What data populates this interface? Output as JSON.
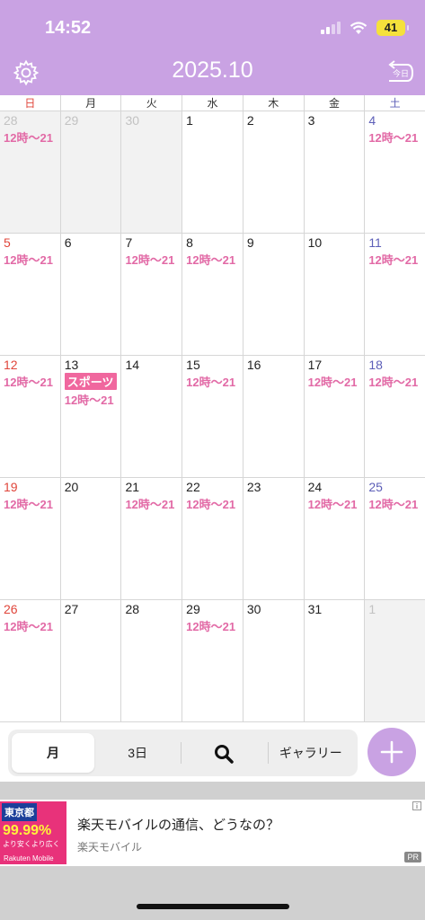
{
  "status": {
    "time": "14:52",
    "battery": "41"
  },
  "header": {
    "title": "2025.10",
    "today_label": "今日"
  },
  "weekdays": [
    "日",
    "月",
    "火",
    "水",
    "木",
    "金",
    "土"
  ],
  "weeks": [
    [
      {
        "day": "28",
        "other": true,
        "shift": "12時～21"
      },
      {
        "day": "29",
        "other": true
      },
      {
        "day": "30",
        "other": true
      },
      {
        "day": "1"
      },
      {
        "day": "2"
      },
      {
        "day": "3"
      },
      {
        "day": "4",
        "shift": "12時～21"
      }
    ],
    [
      {
        "day": "5",
        "shift": "12時～21"
      },
      {
        "day": "6"
      },
      {
        "day": "7",
        "shift": "12時～21"
      },
      {
        "day": "8",
        "shift": "12時～21"
      },
      {
        "day": "9"
      },
      {
        "day": "10"
      },
      {
        "day": "11",
        "shift": "12時～21"
      }
    ],
    [
      {
        "day": "12",
        "shift": "12時～21"
      },
      {
        "day": "13",
        "tag": "スポーツ",
        "shift": "12時～21"
      },
      {
        "day": "14"
      },
      {
        "day": "15",
        "shift": "12時～21"
      },
      {
        "day": "16"
      },
      {
        "day": "17",
        "shift": "12時～21"
      },
      {
        "day": "18",
        "shift": "12時～21"
      }
    ],
    [
      {
        "day": "19",
        "shift": "12時～21"
      },
      {
        "day": "20"
      },
      {
        "day": "21",
        "shift": "12時～21"
      },
      {
        "day": "22",
        "shift": "12時～21"
      },
      {
        "day": "23"
      },
      {
        "day": "24",
        "shift": "12時～21"
      },
      {
        "day": "25",
        "shift": "12時～21"
      }
    ],
    [
      {
        "day": "26",
        "shift": "12時～21"
      },
      {
        "day": "27"
      },
      {
        "day": "28"
      },
      {
        "day": "29",
        "shift": "12時～21"
      },
      {
        "day": "30"
      },
      {
        "day": "31"
      },
      {
        "day": "1",
        "other": true
      }
    ]
  ],
  "toolbar": {
    "month": "月",
    "three_day": "3日",
    "gallery": "ギャラリー"
  },
  "ad": {
    "title": "楽天モバイルの通信、どうなの？",
    "advertiser": "楽天モバイル",
    "pr": "PR",
    "thumb_head": "東京都",
    "thumb_pct": "99.99%",
    "thumb_note": "より安くより広く",
    "thumb_brand": "Rakuten Mobile"
  },
  "colors": {
    "accent": "#c9a2e3",
    "shift": "#e26aa6",
    "tag": "#f0679e",
    "sunday": "#e0453a",
    "saturday": "#5d5fb8"
  },
  "icons": {
    "settings": "gear-icon",
    "today": "today-return-icon",
    "search": "search-icon",
    "add": "plus-icon",
    "ad_info": "info-icon"
  }
}
